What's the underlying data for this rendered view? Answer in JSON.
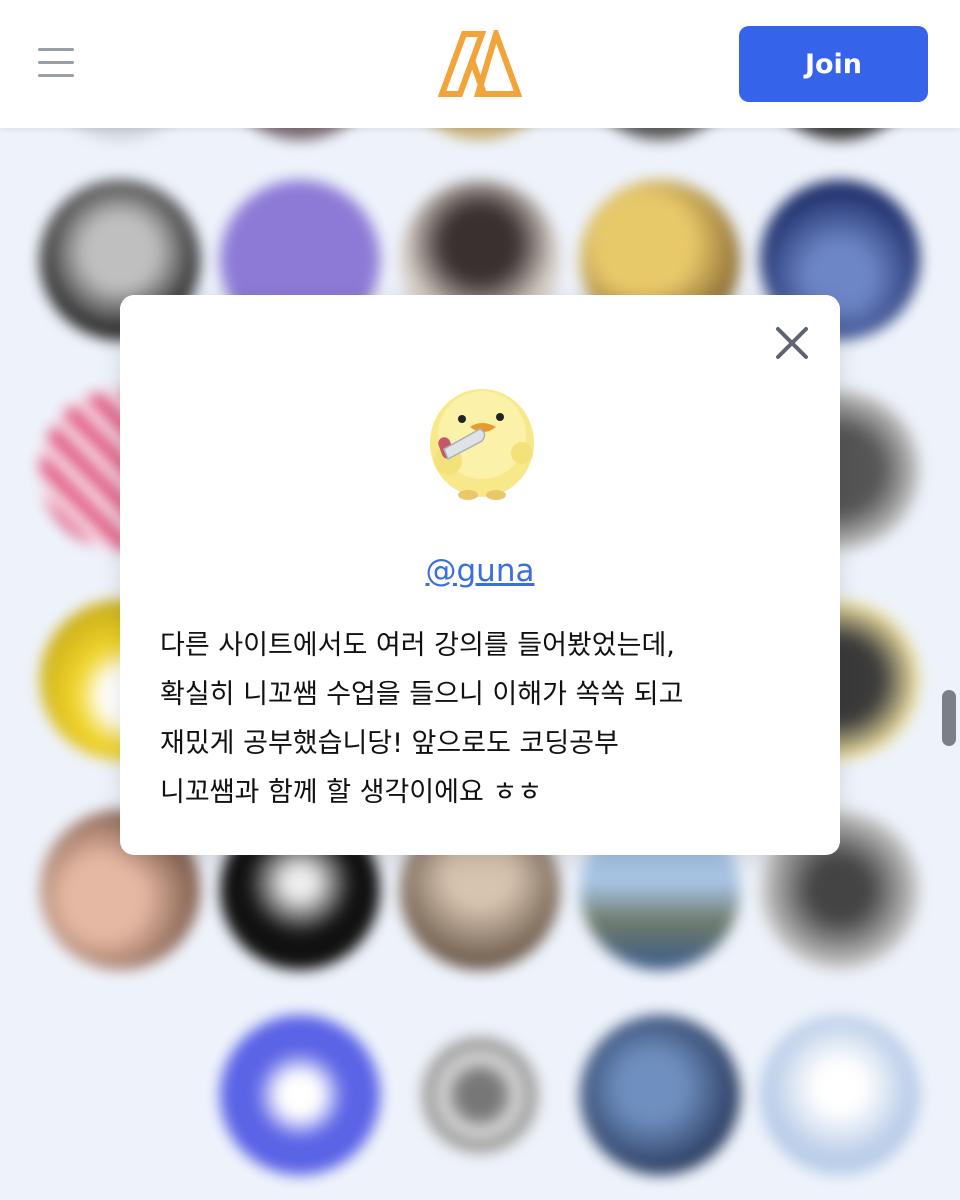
{
  "header": {
    "menu_icon": "hamburger-menu-icon",
    "logo_icon": "brand-logo-icon",
    "join_label": "Join",
    "accent": "#3563e9",
    "logo_color": "#f2a33a"
  },
  "modal": {
    "avatar_icon": "chick-with-knife-avatar",
    "close_icon": "close-icon",
    "username": "@guna",
    "review_lines": [
      "다른 사이트에서도 여러 강의를 들어봤었는데,",
      "확실히 니꼬쌤 수업을 들으니 이해가 쏙쏙 되고",
      "재밌게 공부했습니당! 앞으로도 코딩공부",
      "니꼬쌤과 함께 할 생각이에요 ㅎㅎ"
    ]
  }
}
